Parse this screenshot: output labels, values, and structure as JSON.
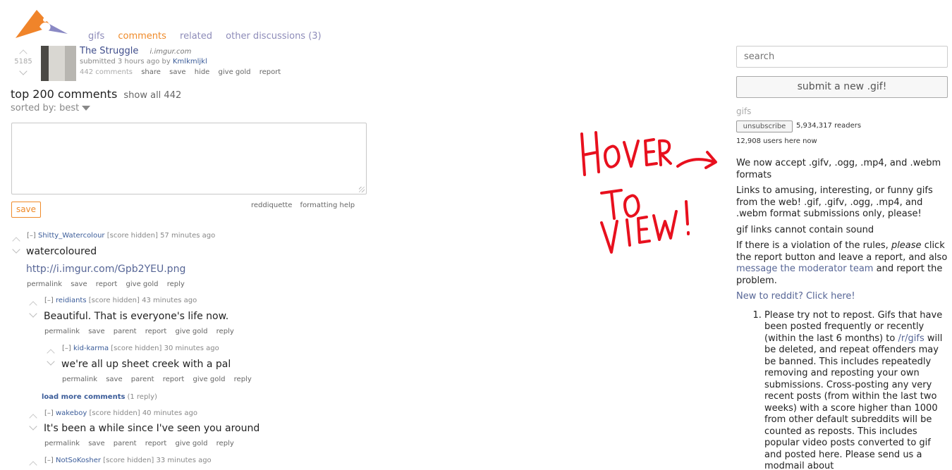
{
  "header": {
    "tabs": [
      {
        "label": "gifs"
      },
      {
        "label": "comments"
      },
      {
        "label": "related"
      },
      {
        "label": "other discussions (3)"
      }
    ]
  },
  "post": {
    "score": "5185",
    "title": "The Struggle",
    "domain": "i.imgur.com",
    "tagline_prefix": "submitted 3 hours ago by",
    "author": "Kmlkmljkl",
    "comments_count": "442 comments",
    "buttons": [
      "share",
      "save",
      "hide",
      "give gold",
      "report"
    ]
  },
  "comment_area": {
    "heading": "top 200 comments",
    "show_all": "show all 442",
    "sorted_by": "sorted by: best",
    "save_label": "save",
    "help_links": [
      "reddiquette",
      "formatting help"
    ]
  },
  "comments": [
    {
      "expand": "[–]",
      "author": "Shitty_Watercolour",
      "score": "[score hidden]",
      "time": "57 minutes ago",
      "body": "watercoloured",
      "link": "http://i.imgur.com/Gpb2YEU.png",
      "buttons": [
        "permalink",
        "save",
        "report",
        "give gold",
        "reply"
      ]
    },
    {
      "expand": "[–]",
      "author": "reidiants",
      "score": "[score hidden]",
      "time": "43 minutes ago",
      "body": "Beautiful. That is everyone's life now.",
      "buttons": [
        "permalink",
        "save",
        "parent",
        "report",
        "give gold",
        "reply"
      ]
    },
    {
      "expand": "[–]",
      "author": "kid-karma",
      "score": "[score hidden]",
      "time": "30 minutes ago",
      "body": "we're all up sheet creek with a pal",
      "buttons": [
        "permalink",
        "save",
        "parent",
        "report",
        "give gold",
        "reply"
      ]
    },
    {
      "expand": "[–]",
      "author": "wakeboy",
      "score": "[score hidden]",
      "time": "40 minutes ago",
      "body": "It's been a while since I've seen you around",
      "buttons": [
        "permalink",
        "save",
        "parent",
        "report",
        "give gold",
        "reply"
      ]
    },
    {
      "expand": "[–]",
      "author": "NotSoKosher",
      "score": "[score hidden]",
      "time": "33 minutes ago"
    }
  ],
  "load_more": {
    "label": "load more comments",
    "count": "(1 reply)"
  },
  "overlay": {
    "text": "HOVER TO VIEW!"
  },
  "sidebar": {
    "search_placeholder": "search",
    "submit_label": "submit a new .gif!",
    "subreddit": "gifs",
    "unsubscribe_label": "unsubscribe",
    "readers": "5,934,317 readers",
    "online": "12,908 users here now",
    "p1": "We now accept .gifv, .ogg, .mp4, and .webm formats",
    "p2": "Links to amusing, interesting, or funny gifs from the web! .gif, .gifv, .ogg, .mp4, and .webm format submissions only, please!",
    "p3": "gif links cannot contain sound",
    "p4_a": "If there is a violation of the rules,",
    "p4_em": "please",
    "p4_b": "click the report button and leave a report, and also",
    "p4_link": "message the moderator team",
    "p4_c": "and report the problem.",
    "new_link": "New to reddit? Click here!",
    "rule1_a": "Please try not to repost. Gifs that have been posted frequently or recently (within the last 6 months) to",
    "rule1_link": "/r/gifs",
    "rule1_b": "will be deleted, and repeat offenders may be banned. This includes repeatedly removing and reposting your own submissions. Cross-posting any very recent posts (from within the last two weeks) with a score higher than 1000 from other default subreddits will be counted as reposts. This includes popular video posts converted to gif and posted here. Please send us a modmail about"
  },
  "colors": {
    "accent": "#ef8a29",
    "link": "#576696",
    "overlay_red": "#e8101e"
  }
}
